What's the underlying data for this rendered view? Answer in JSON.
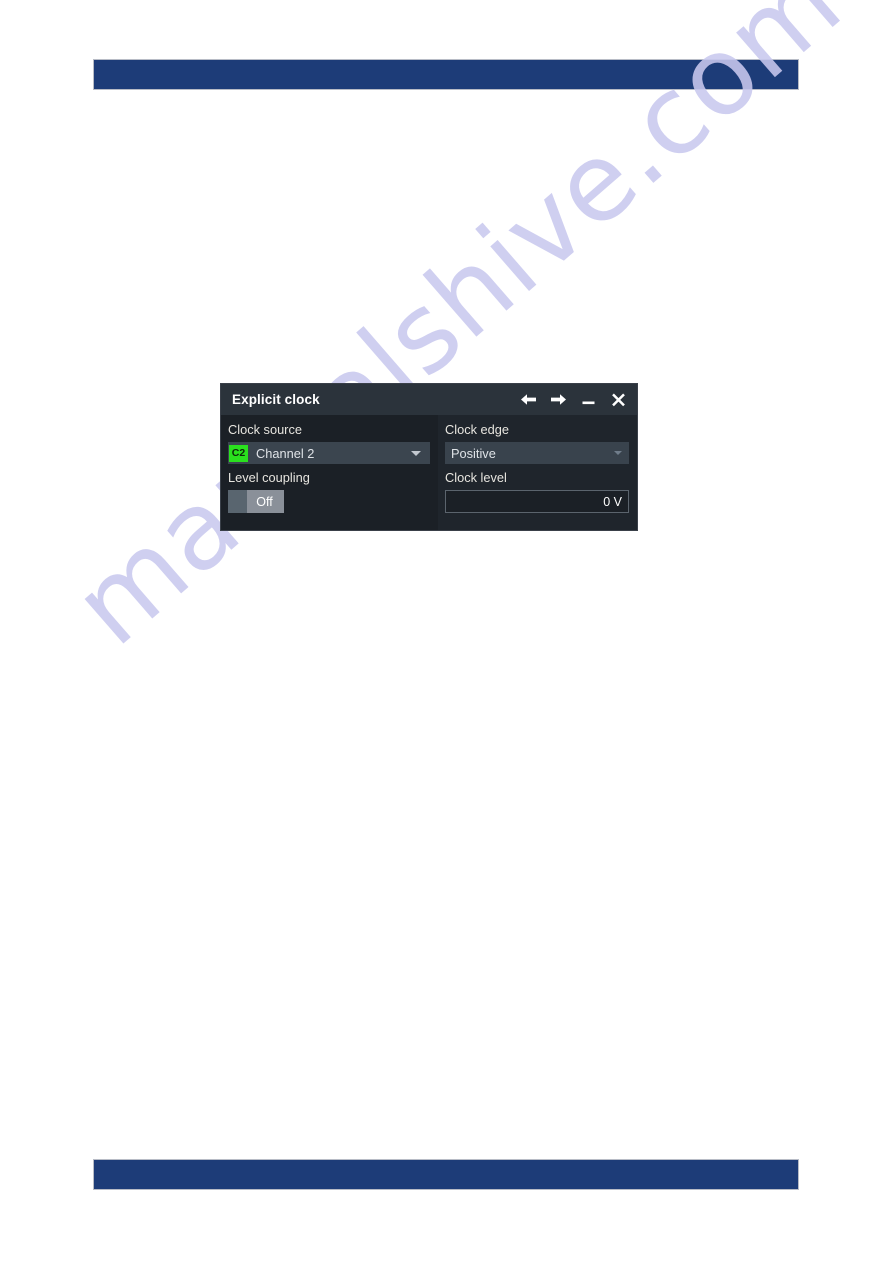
{
  "page": {
    "background_color": "#ffffff",
    "rule_bar_color": "#1d3c78",
    "watermark": "manualshive.com"
  },
  "dialog": {
    "title": "Explicit clock",
    "titlebar_buttons": [
      {
        "name": "back-arrow-icon",
        "glyph": "←"
      },
      {
        "name": "forward-arrow-icon",
        "glyph": "→"
      },
      {
        "name": "minimize-icon",
        "glyph": "—"
      },
      {
        "name": "close-icon",
        "glyph": "✕"
      }
    ],
    "fields": {
      "clock_source": {
        "label": "Clock source",
        "channel_badge": "C2",
        "value": "Channel 2",
        "badge_color": "#2ae01e"
      },
      "clock_edge": {
        "label": "Clock edge",
        "value": "Positive"
      },
      "level_coupling": {
        "label": "Level coupling",
        "value": "Off"
      },
      "clock_level": {
        "label": "Clock level",
        "value": "0 V"
      }
    }
  }
}
